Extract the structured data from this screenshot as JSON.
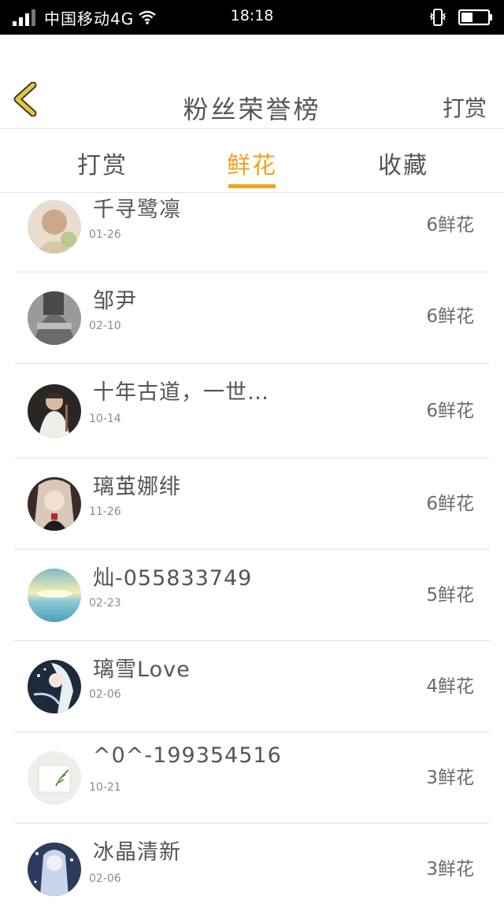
{
  "status_bar": {
    "carrier": "中国移动4G",
    "time": "18:18"
  },
  "nav": {
    "title": "粉丝荣誉榜",
    "right_action": "打赏"
  },
  "tabs": [
    {
      "label": "打赏",
      "active": false
    },
    {
      "label": "鲜花",
      "active": true
    },
    {
      "label": "收藏",
      "active": false
    }
  ],
  "colors": {
    "accent": "#f0a21c",
    "back_icon": "#e8c637",
    "text": "#555555"
  },
  "fans": [
    {
      "name": "千寻鹭凛",
      "date": "01-26",
      "count": "6鲜花",
      "avatar": "anime-girl-avatar"
    },
    {
      "name": "邹尹",
      "date": "02-10",
      "count": "6鲜花",
      "avatar": "grayscale-person-avatar"
    },
    {
      "name": "十年古道，一世…",
      "date": "10-14",
      "count": "6鲜花",
      "avatar": "young-man-avatar"
    },
    {
      "name": "璃茧娜绯",
      "date": "11-26",
      "count": "6鲜花",
      "avatar": "anime-girl-avatar"
    },
    {
      "name": "灿-055833749",
      "date": "02-23",
      "count": "5鲜花",
      "avatar": "seascape-avatar"
    },
    {
      "name": "璃雪Love",
      "date": "02-06",
      "count": "4鲜花",
      "avatar": "anime-white-hair-avatar"
    },
    {
      "name": "^0^-199354516",
      "date": "10-21",
      "count": "3鲜花",
      "avatar": "leaf-card-avatar"
    },
    {
      "name": "冰晶清新",
      "date": "02-06",
      "count": "3鲜花",
      "avatar": "blue-anime-avatar"
    }
  ]
}
